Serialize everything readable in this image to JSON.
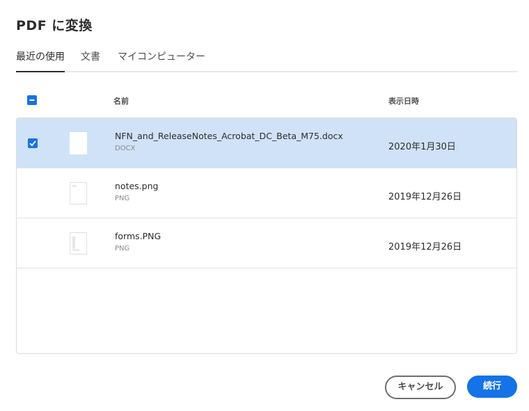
{
  "dialog": {
    "title": "PDF に変換"
  },
  "tabs": [
    {
      "label": "最近の使用",
      "selected": true
    },
    {
      "label": "文書",
      "selected": false
    },
    {
      "label": "マイコンピューター",
      "selected": false
    }
  ],
  "table": {
    "columns": {
      "name": "名前",
      "date": "表示日時"
    },
    "select_all_state": "indeterminate",
    "rows": [
      {
        "name": "NFN_and_ReleaseNotes_Acrobat_DC_Beta_M75.docx",
        "type": "DOCX",
        "date": "2020年1月30日",
        "selected": true
      },
      {
        "name": "notes.png",
        "type": "PNG",
        "date": "2019年12月26日",
        "selected": false
      },
      {
        "name": "forms.PNG",
        "type": "PNG",
        "date": "2019年12月26日",
        "selected": false
      }
    ]
  },
  "buttons": {
    "cancel": "キャンセル",
    "continue": "続行"
  },
  "colors": {
    "accent": "#1473e6",
    "selected_row": "#cfe2f7"
  }
}
